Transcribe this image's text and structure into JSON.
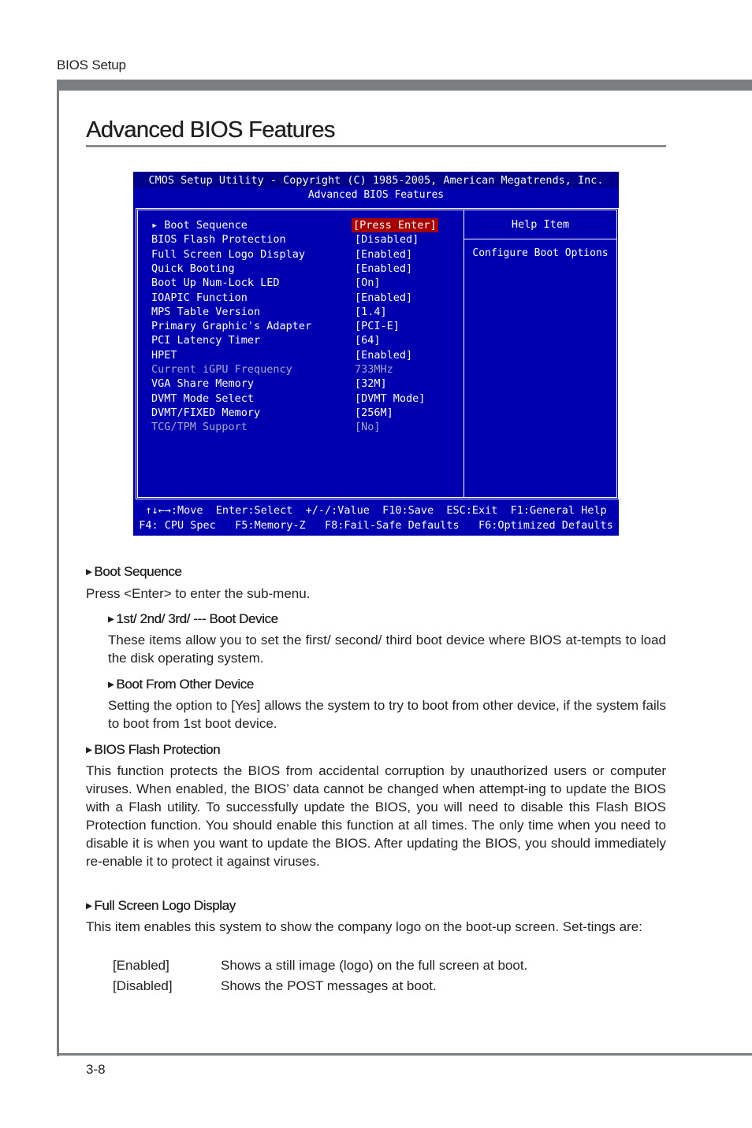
{
  "running_head": "BIOS Setup",
  "page_title": "Advanced BIOS Features",
  "bios": {
    "header": "CMOS Setup Utility - Copyright (C) 1985-2005, American Megatrends, Inc.",
    "subtitle": "Advanced BIOS Features",
    "items": [
      {
        "label": "▸ Boot Sequence",
        "value": "[Press Enter]",
        "selected": true,
        "disabled": false
      },
      {
        "label": "BIOS Flash Protection",
        "value": "[Disabled]",
        "selected": false,
        "disabled": false
      },
      {
        "label": "Full Screen Logo Display",
        "value": "[Enabled]",
        "selected": false,
        "disabled": false
      },
      {
        "label": "Quick Booting",
        "value": "[Enabled]",
        "selected": false,
        "disabled": false
      },
      {
        "label": "Boot Up Num-Lock LED",
        "value": "[On]",
        "selected": false,
        "disabled": false
      },
      {
        "label": "IOAPIC Function",
        "value": "[Enabled]",
        "selected": false,
        "disabled": false
      },
      {
        "label": "MPS Table Version",
        "value": "[1.4]",
        "selected": false,
        "disabled": false
      },
      {
        "label": "Primary Graphic's Adapter",
        "value": "[PCI-E]",
        "selected": false,
        "disabled": false
      },
      {
        "label": "PCI Latency Timer",
        "value": "[64]",
        "selected": false,
        "disabled": false
      },
      {
        "label": "HPET",
        "value": "[Enabled]",
        "selected": false,
        "disabled": false
      },
      {
        "label": "Current iGPU Frequency",
        "value": "733MHz",
        "selected": false,
        "disabled": true
      },
      {
        "label": "VGA Share Memory",
        "value": "[32M]",
        "selected": false,
        "disabled": false
      },
      {
        "label": "DVMT Mode Select",
        "value": "[DVMT Mode]",
        "selected": false,
        "disabled": false
      },
      {
        "label": "DVMT/FIXED Memory",
        "value": "[256M]",
        "selected": false,
        "disabled": false
      },
      {
        "label": "TCG/TPM Support",
        "value": "[No]",
        "selected": false,
        "disabled": true
      }
    ],
    "help_title": "Help Item",
    "help_text": "Configure Boot Options",
    "footer_line1": "↑↓←→:Move  Enter:Select  +/-/:Value  F10:Save  ESC:Exit  F1:General Help",
    "footer_line2": "F4: CPU Spec   F5:Memory-Z   F8:Fail-Safe Defaults   F6:Optimized Defaults"
  },
  "sections": {
    "boot_sequence": {
      "heading": "Boot Sequence",
      "text": "Press <Enter> to enter the sub-menu."
    },
    "boot_device": {
      "heading": "1st/ 2nd/ 3rd/ --- Boot Device",
      "text": "These items allow you to set the first/ second/ third boot device where BIOS at-tempts to load the disk operating system."
    },
    "boot_other": {
      "heading": "Boot From Other Device",
      "text": "Setting the option to [Yes] allows the system to try to boot from other device, if the system fails to boot from 1st boot device."
    },
    "flash_protection": {
      "heading": "BIOS Flash Protection",
      "text": "This function protects the BIOS from accidental corruption by unauthorized users or computer viruses. When enabled, the BIOS’ data cannot be changed when attempt-ing to update the BIOS with a Flash utility. To successfully update the BIOS, you will need to disable this Flash BIOS Protection function. You should enable this function at all times. The only time when you need to disable it is when you want to update the BIOS. After updating the BIOS, you should immediately re-enable it to protect it against viruses."
    },
    "logo_display": {
      "heading": "Full Screen Logo Display",
      "text": "This item enables this system to show the company logo on the boot-up screen. Set-tings are:",
      "options": [
        {
          "key": "[Enabled]",
          "desc": "Shows a still image (logo) on the full screen at boot."
        },
        {
          "key": "[Disabled]",
          "desc": "Shows the POST messages at boot."
        }
      ]
    }
  },
  "page_number": "3-8"
}
